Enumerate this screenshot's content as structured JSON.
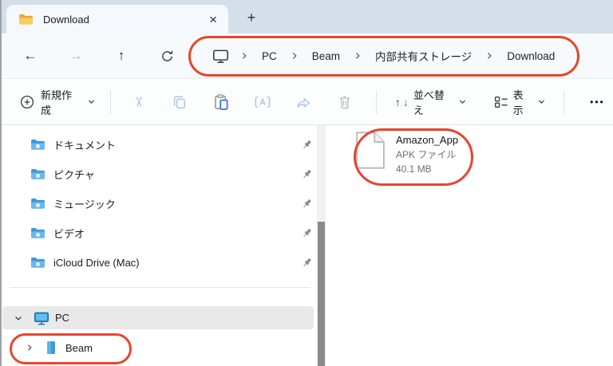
{
  "tab_bar": {
    "tab_title": "Download",
    "close_glyph": "×",
    "new_tab_glyph": "+"
  },
  "address_bar": {
    "back_glyph": "←",
    "forward_glyph": "→",
    "up_glyph": "↑",
    "breadcrumb": {
      "items": [
        "PC",
        "Beam",
        "内部共有ストレージ",
        "Download"
      ]
    }
  },
  "toolbar": {
    "new_label": "新規作成",
    "cut_glyph": "✂",
    "sort_label": "並べ替え",
    "sort_up_glyph": "↑",
    "sort_down_glyph": "↓",
    "view_label": "表示",
    "more_glyph": "•••"
  },
  "sidebar": {
    "pinned": [
      {
        "label": "ドキュメント",
        "icon": "documents-folder-icon"
      },
      {
        "label": "ピクチャ",
        "icon": "pictures-folder-icon"
      },
      {
        "label": "ミュージック",
        "icon": "music-folder-icon"
      },
      {
        "label": "ビデオ",
        "icon": "videos-folder-icon"
      },
      {
        "label": "iCloud Drive (Mac)",
        "icon": "icloud-folder-icon"
      }
    ],
    "tree": {
      "pc_label": "PC",
      "beam_label": "Beam"
    }
  },
  "main": {
    "file": {
      "name": "Amazon_App",
      "type_label": "APK ファイル",
      "size_label": "40.1 MB"
    }
  },
  "annotations": {
    "color": "#e8442e",
    "targets": [
      "breadcrumb-path",
      "amazon-app-file",
      "sidebar-beam-device"
    ]
  }
}
